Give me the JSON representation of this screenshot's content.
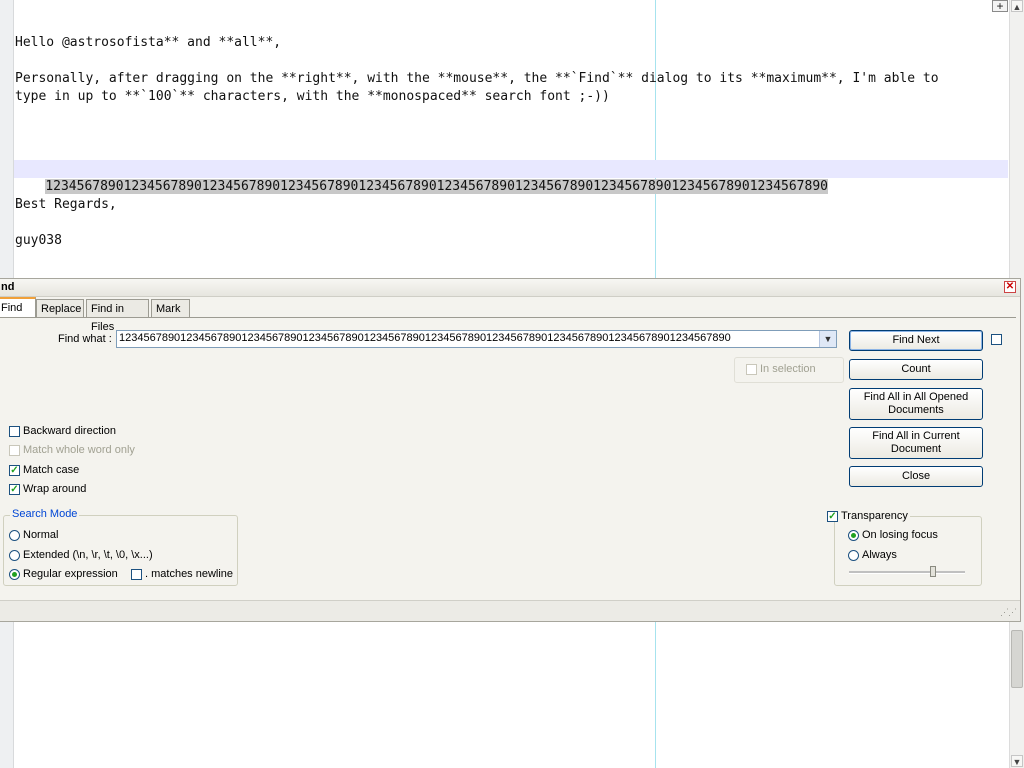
{
  "editor": {
    "lines": [
      "Hello @astrosofista** and **all**,",
      "Personally, after dragging on the **right**, with the **mouse**, the **`Find`** dialog to its **maximum**, I'm able to",
      "type in up to **`100`** characters, with the **monospaced** search font ;-))",
      "1234567890123456789012345678901234567890123456789012345678901234567890123456789012345678901234567890",
      "Best Regards,",
      "guy038"
    ],
    "plus_label": "+"
  },
  "dialog": {
    "title": "nd",
    "close_glyph": "✕",
    "tabs": [
      "Find",
      "Replace",
      "Find in Files",
      "Mark"
    ],
    "find_what_label": "Find what :",
    "find_what_value": "1234567890123456789012345678901234567890123456789012345678901234567890123456789012345678901234567890",
    "buttons": {
      "find_next": "Find Next",
      "count": "Count",
      "find_all_opened_1": "Find All in All Opened",
      "find_all_opened_2": "Documents",
      "find_all_current_1": "Find All in Current",
      "find_all_current_2": "Document",
      "close": "Close"
    },
    "in_selection": "In selection",
    "options": {
      "backward": "Backward direction",
      "whole_word": "Match whole word only",
      "match_case": "Match case",
      "wrap_around": "Wrap around"
    },
    "search_mode": {
      "legend": "Search Mode",
      "normal": "Normal",
      "extended": "Extended (\\n, \\r, \\t, \\0, \\x...)",
      "regex": "Regular expression",
      "matches_newline": ". matches newline"
    },
    "transparency": {
      "label": "Transparency",
      "on_losing_focus": "On losing focus",
      "always": "Always",
      "level": 0.72
    }
  },
  "colors": {
    "accent_check": "#21a121",
    "group_legend": "#0046d5",
    "current_line": "#e8e8ff"
  }
}
